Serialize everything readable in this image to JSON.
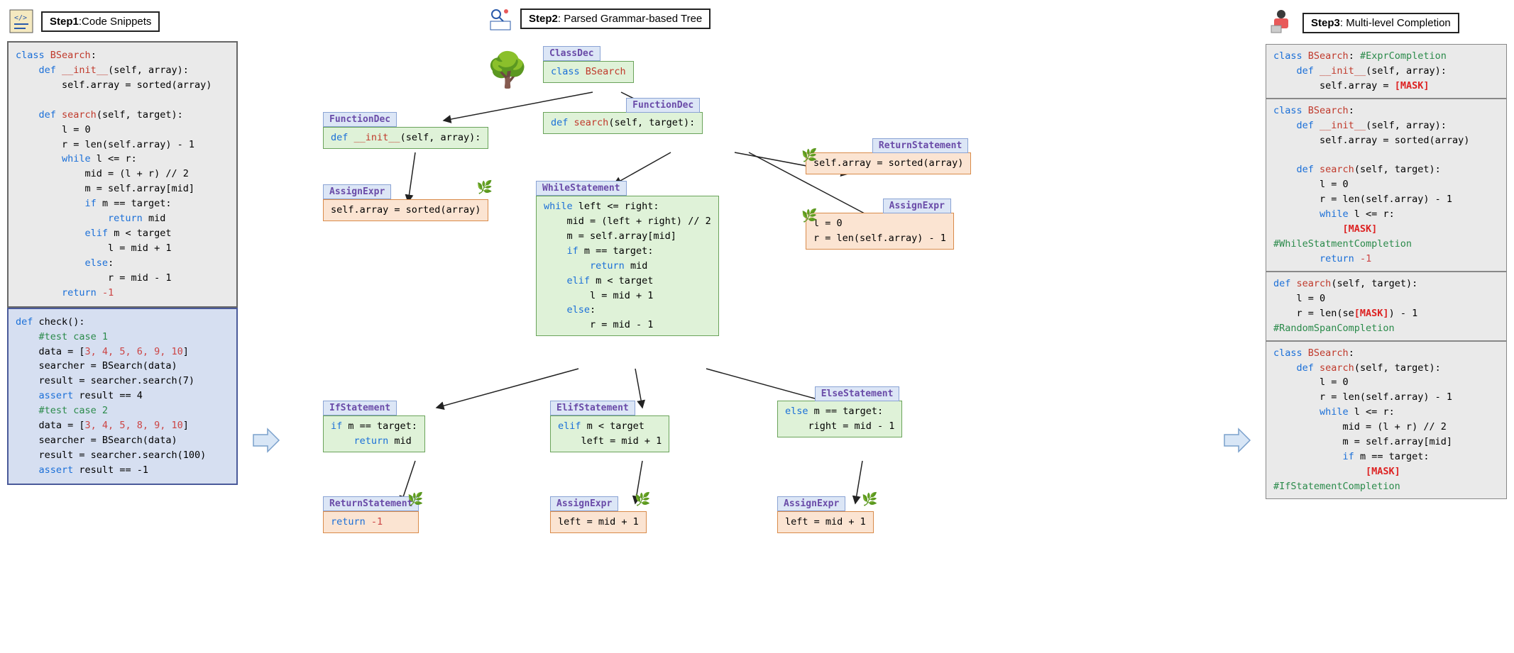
{
  "step1": {
    "label": "Step1",
    "title": ":Code Snippets"
  },
  "step2": {
    "label": "Step2",
    "title": ": Parsed Grammar-based Tree"
  },
  "step3": {
    "label": "Step3",
    "title": ": Multi-level Completion"
  },
  "code1": {
    "l1a": "class",
    "l1b": "BSearch",
    "l1c": ":",
    "l2a": "def",
    "l2b": "__init__",
    "l2c": "(self, array):",
    "l3": "        self.array = sorted(array)",
    "l5a": "def",
    "l5b": "search",
    "l5c": "(self, target):",
    "l6": "        l = 0",
    "l7": "        r = len(self.array) - 1",
    "l8a": "while",
    "l8b": " l <= r:",
    "l9": "            mid = (l + r) // 2",
    "l10": "            m = self.array[mid]",
    "l11a": "if",
    "l11b": " m == target:",
    "l12a": "return",
    "l12b": " mid",
    "l13a": "elif",
    "l13b": " m < target",
    "l14": "                l = mid + 1",
    "l15a": "else",
    "l15b": ":",
    "l16": "                r = mid - 1",
    "l17a": "return",
    "l17b": " -1"
  },
  "code2": {
    "l1a": "def",
    "l1b": " check():",
    "l2": "    #test case 1",
    "l3a": "    data = [",
    "l3b": "3, 4, 5, 6, 9, 10",
    "l3c": "]",
    "l4": "    searcher = BSearch(data)",
    "l5": "    result = searcher.search(7)",
    "l6a": "assert",
    "l6b": " result == 4",
    "l7": "    #test case 2",
    "l8a": "    data = [",
    "l8b": "3, 4, 5, 8, 9, 10",
    "l8c": "]",
    "l9": "    searcher = BSearch(data)",
    "l10": "    result = searcher.search(100)",
    "l11a": "assert",
    "l11b": " result == -1"
  },
  "tree": {
    "classdec": {
      "label": "ClassDec",
      "code_a": "class",
      "code_b": "BSearch"
    },
    "fdec1": {
      "label": "FunctionDec",
      "code_a": "def",
      "code_b": "__init__",
      "code_c": "(self, array):"
    },
    "fdec2": {
      "label": "FunctionDec",
      "code_a": "def",
      "code_b": "search",
      "code_c": "(self, target):"
    },
    "assign1": {
      "label": "AssignExpr",
      "code": "self.array = sorted(array)"
    },
    "return1": {
      "label": "ReturnStatement",
      "code": "self.array = sorted(array)"
    },
    "assign2": {
      "label": "AssignExpr",
      "line1": "l = 0",
      "line2": "r = len(self.array) - 1"
    },
    "while": {
      "label": "WhileStatement",
      "l1a": "while",
      "l1b": " left <= right:",
      "l2": "    mid = (left + right) // 2",
      "l3": "    m = self.array[mid]",
      "l4a": "if",
      "l4b": " m == target:",
      "l5a": "return",
      "l5b": " mid",
      "l6a": "elif",
      "l6b": " m < target",
      "l7": "        l = mid + 1",
      "l8a": "else",
      "l8b": ":",
      "l9": "        r = mid - 1"
    },
    "if": {
      "label": "IfStatement",
      "l1a": "if",
      "l1b": " m == target:",
      "l2a": "return",
      "l2b": " mid"
    },
    "elif": {
      "label": "ElifStatement",
      "l1a": "elif",
      "l1b": " m < target",
      "l2": "    left = mid + 1"
    },
    "else": {
      "label": "ElseStatement",
      "l1": "else m == target:",
      "l2": "    right = mid - 1"
    },
    "return2": {
      "label": "ReturnStatement",
      "code_a": "return",
      "code_b": " -1"
    },
    "assign3": {
      "label": "AssignExpr",
      "code": "left = mid + 1"
    },
    "assign4": {
      "label": "AssignExpr",
      "code": "left = mid + 1"
    }
  },
  "r1": {
    "l1a": "class",
    "l1b": "BSearch",
    "l1c": ":",
    "l1d": "#ExprCompletion",
    "l2a": "def",
    "l2b": "__init__",
    "l2c": "(self, array):",
    "l3a": "        self.array = ",
    "l3b": "[MASK]"
  },
  "r2": {
    "l1a": "class",
    "l1b": "BSearch",
    "l1c": ":",
    "l2a": "def",
    "l2b": "__init__",
    "l2c": "(self, array):",
    "l3": "        self.array = sorted(array)",
    "l5a": "def",
    "l5b": "search",
    "l5c": "(self, target):",
    "l6": "        l = 0",
    "l7": "        r = len(self.array) - 1",
    "l8a": "while",
    "l8b": " l <= r:",
    "l9": "[MASK]",
    "c1": "#WhileStatmentCompletion",
    "l10a": "return",
    "l10b": " -1"
  },
  "r3": {
    "l1a": "def",
    "l1b": "search",
    "l1c": "(self, target):",
    "l2": "    l = 0",
    "l3a": "    r = len(se",
    "l3b": "[MASK]",
    "l3c": ") - 1",
    "c1": "#RandomSpanCompletion"
  },
  "r4": {
    "l1a": "class",
    "l1b": "BSearch",
    "l1c": ":",
    "l2a": "def",
    "l2b": "search",
    "l2c": "(self, target):",
    "l3": "        l = 0",
    "l4": "        r = len(self.array) - 1",
    "l5a": "while",
    "l5b": " l <= r:",
    "l6": "            mid = (l + r) // 2",
    "l7": "            m = self.array[mid]",
    "l8a": "if",
    "l8b": " m == target:",
    "l9": "[MASK]",
    "c1": "#IfStatementCompletion"
  }
}
